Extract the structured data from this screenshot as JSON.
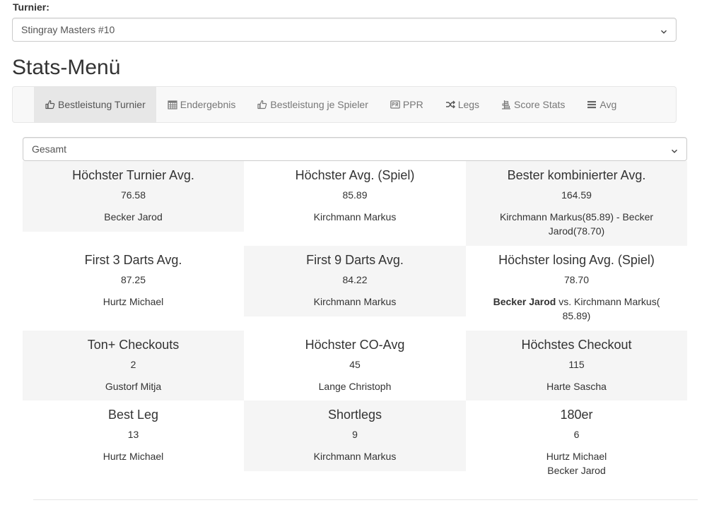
{
  "turnier": {
    "label": "Turnier:",
    "selected": "Stingray Masters #10"
  },
  "page_title": "Stats-Menü",
  "nav": {
    "items": [
      {
        "label": "Bestleistung Turnier",
        "icon": "thumbs-up-icon",
        "active": true
      },
      {
        "label": "Endergebnis",
        "icon": "calendar-grid-icon",
        "active": false
      },
      {
        "label": "Bestleistung je Spieler",
        "icon": "thumbs-up-icon",
        "active": false
      },
      {
        "label": "PPR",
        "icon": "ppr-badge-icon",
        "active": false
      },
      {
        "label": "Legs",
        "icon": "shuffle-icon",
        "active": false
      },
      {
        "label": "Score Stats",
        "icon": "bar-align-icon",
        "active": false
      },
      {
        "label": "Avg",
        "icon": "list-icon",
        "active": false
      }
    ]
  },
  "filter": {
    "selected": "Gesamt"
  },
  "stats": [
    {
      "title": "Höchster Turnier Avg.",
      "value": "76.58",
      "player": "Becker Jarod"
    },
    {
      "title": "Höchster Avg. (Spiel)",
      "value": "85.89",
      "player": "Kirchmann Markus"
    },
    {
      "title": "Bester kombinierter Avg.",
      "value": "164.59",
      "player": "Kirchmann Markus(85.89) - Becker Jarod(78.70)"
    },
    {
      "title": "First 3 Darts Avg.",
      "value": "87.25",
      "player": "Hurtz Michael"
    },
    {
      "title": "First 9 Darts Avg.",
      "value": "84.22",
      "player": "Kirchmann Markus"
    },
    {
      "title": "Höchster losing Avg. (Spiel)",
      "value": "78.70",
      "player_bold": "Becker Jarod",
      "player": " vs. Kirchmann Markus( 85.89)"
    },
    {
      "title": "Ton+ Checkouts",
      "value": "2",
      "player": "Gustorf Mitja"
    },
    {
      "title": "Höchster CO-Avg",
      "value": "45",
      "player": "Lange Christoph"
    },
    {
      "title": "Höchstes Checkout",
      "value": "115",
      "player": "Harte Sascha"
    },
    {
      "title": "Best Leg",
      "value": "13",
      "player": "Hurtz Michael"
    },
    {
      "title": "Shortlegs",
      "value": "9",
      "player": "Kirchmann Markus"
    },
    {
      "title": "180er",
      "value": "6",
      "player": "Hurtz Michael",
      "player2": "Becker Jarod"
    }
  ]
}
